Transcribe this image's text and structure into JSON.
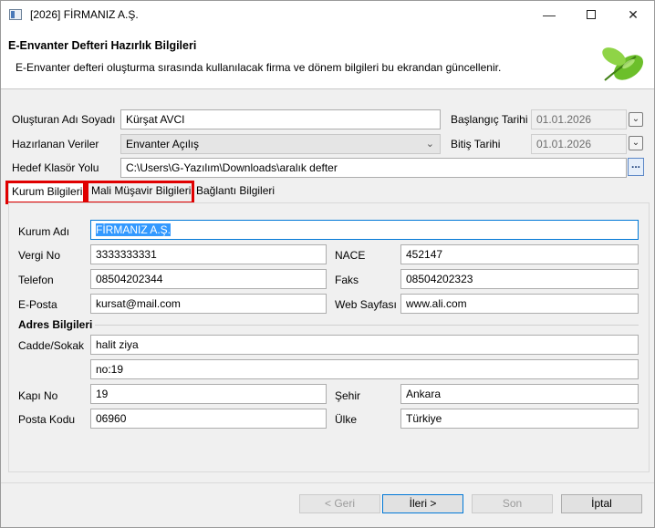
{
  "window": {
    "title": "[2026] FİRMANIZ A.Ş.",
    "minimize": "—",
    "close": "✕"
  },
  "header": {
    "title": "E-Envanter Defteri Hazırlık Bilgileri",
    "subtitle": "E-Envanter defteri oluşturma sırasında kullanılacak firma ve dönem bilgileri bu ekrandan güncellenir.",
    "logo_icon": "green-leaf-icon"
  },
  "form": {
    "creator_label": "Oluşturan Adı Soyadı",
    "creator_value": "Kürşat AVCI",
    "data_label": "Hazırlanan Veriler",
    "data_value": "Envanter Açılış",
    "folder_label": "Hedef Klasör Yolu",
    "folder_value": "C:\\Users\\G-Yazılım\\Downloads\\aralık defter",
    "browse_label": "...",
    "start_label": "Başlangıç Tarihi",
    "start_value": "01.01.2026",
    "end_label": "Bitiş Tarihi",
    "end_value": "01.01.2026",
    "dropdown_glyph": "⌄",
    "combo_arrow": "⌄"
  },
  "tabs": [
    {
      "label": "Kurum Bilgileri",
      "active": true
    },
    {
      "label": "Mali Müşavir Bilgileri",
      "active": false
    },
    {
      "label": "Bağlantı Bilgileri",
      "active": false
    }
  ],
  "kurum": {
    "name_label": "Kurum Adı",
    "name_value": "FİRMANIZ A.Ş.",
    "tax_label": "Vergi No",
    "tax_value": "3333333331",
    "nace_label": "NACE",
    "nace_value": "452147",
    "phone_label": "Telefon",
    "phone_value": "08504202344",
    "fax_label": "Faks",
    "fax_value": "08504202323",
    "email_label": "E-Posta",
    "email_value": "kursat@mail.com",
    "web_label": "Web Sayfası",
    "web_value": "www.ali.com",
    "address_group": "Adres Bilgileri",
    "street_label": "Cadde/Sokak",
    "street_value1": "halit ziya",
    "street_value2": "no:19",
    "door_label": "Kapı No",
    "door_value": "19",
    "city_label": "Şehir",
    "city_value": "Ankara",
    "postal_label": "Posta Kodu",
    "postal_value": "06960",
    "country_label": "Ülke",
    "country_value": "Türkiye"
  },
  "buttons": {
    "back": "< Geri",
    "next": "İleri >",
    "finish": "Son",
    "cancel": "İptal"
  },
  "colors": {
    "highlight_box": "#e00000",
    "selection": "#3399ff",
    "focus_border": "#0078d7"
  }
}
